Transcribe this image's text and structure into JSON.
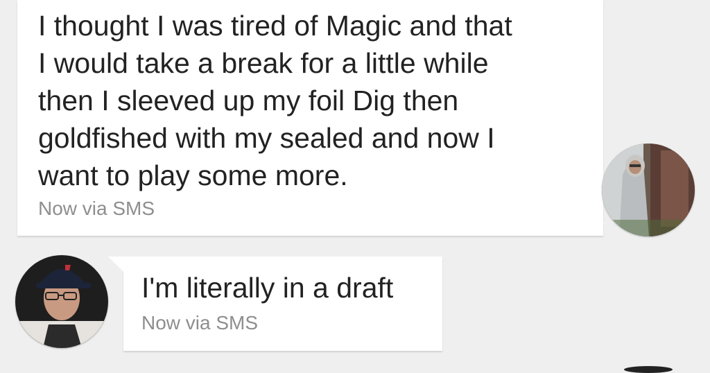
{
  "messages": [
    {
      "direction": "outgoing",
      "text": "I thought I was tired of Magic and that\nI would take a break for a little while\nthen I sleeved up my foil Dig then\ngoldfished with my sealed and now I\nwant to play some more.",
      "meta": "Now via SMS",
      "avatar_icon": "person-in-hooded-gray-robe-avatar"
    },
    {
      "direction": "incoming",
      "text": "I'm literally in a draft",
      "meta": "Now via SMS",
      "avatar_icon": "man-in-baseball-cap-avatar"
    }
  ],
  "colors": {
    "background": "#efefef",
    "bubble": "#ffffff",
    "text": "#222222",
    "meta": "#8e8e8e"
  }
}
